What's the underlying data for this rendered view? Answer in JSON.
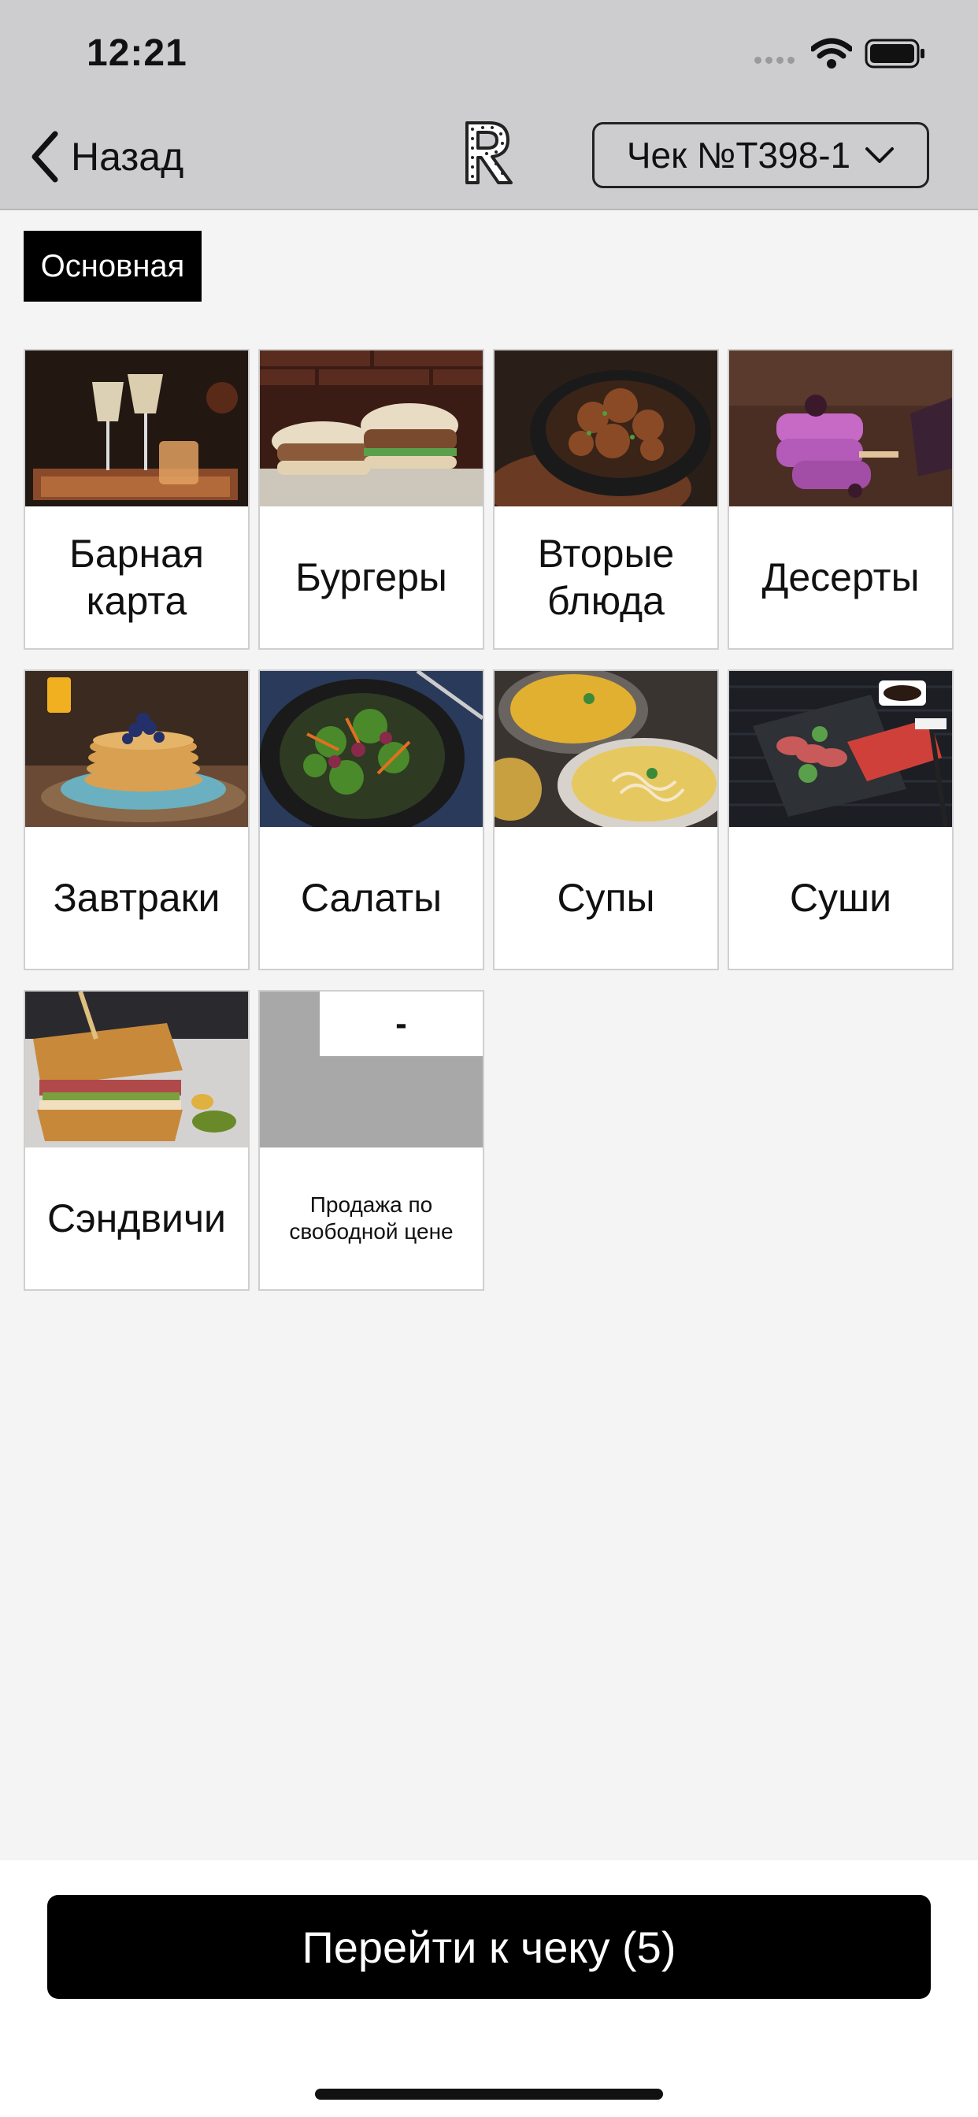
{
  "status_bar": {
    "time": "12:21"
  },
  "nav": {
    "back_label": "Назад",
    "check_label": "Чек №T398-1"
  },
  "tabs": [
    {
      "label": "Основная",
      "selected": true
    }
  ],
  "categories": [
    {
      "name": "Барная карта",
      "image": "cocktails-photo"
    },
    {
      "name": "Бургеры",
      "image": "burgers-photo"
    },
    {
      "name": "Вторые блюда",
      "image": "main-dish-photo"
    },
    {
      "name": "Десерты",
      "image": "desserts-photo"
    },
    {
      "name": "Завтраки",
      "image": "pancakes-photo"
    },
    {
      "name": "Салаты",
      "image": "salad-photo"
    },
    {
      "name": "Супы",
      "image": "soup-photo"
    },
    {
      "name": "Суши",
      "image": "sushi-photo"
    },
    {
      "name": "Сэндвичи",
      "image": "sandwich-photo"
    },
    {
      "name": "Продажа по свободной цене",
      "image": "placeholder",
      "price_placeholder": "-"
    }
  ],
  "footer": {
    "go_to_check_label": "Перейти к чеку (5)"
  },
  "colors": {
    "accent": "#000000",
    "topbar": "#cdcdcf",
    "background": "#f4f4f4"
  }
}
